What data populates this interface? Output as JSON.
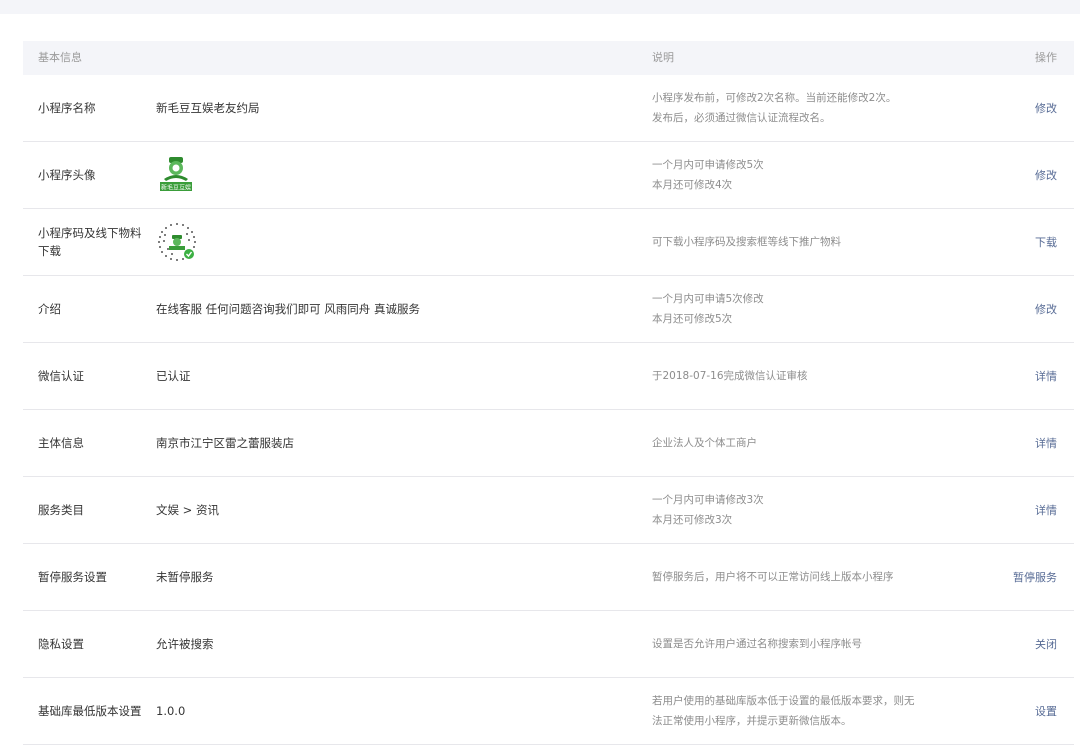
{
  "header": {
    "col_basic": "基本信息",
    "col_desc": "说明",
    "col_op": "操作"
  },
  "rows": [
    {
      "label": "小程序名称",
      "value": "新毛豆互娱老友约局",
      "desc1": "小程序发布前，可修改2次名称。当前还能修改2次。",
      "desc2": "发布后，必须通过微信认证流程改名。",
      "op": "修改"
    },
    {
      "label": "小程序头像",
      "value": "",
      "desc1": "一个月内可申请修改5次",
      "desc2": "本月还可修改4次",
      "op": "修改"
    },
    {
      "label": "小程序码及线下物料下载",
      "value": "",
      "desc1": "可下载小程序码及搜索框等线下推广物料",
      "desc2": "",
      "op": "下载"
    },
    {
      "label": "介绍",
      "value": "在线客服 任何问题咨询我们即可 风雨同舟 真诚服务",
      "desc1": "一个月内可申请5次修改",
      "desc2": "本月还可修改5次",
      "op": "修改"
    },
    {
      "label": "微信认证",
      "value": "已认证",
      "desc1": "于2018-07-16完成微信认证审核",
      "desc2": "",
      "op": "详情"
    },
    {
      "label": "主体信息",
      "value": "南京市江宁区雷之蕾服装店",
      "desc1": "企业法人及个体工商户",
      "desc2": "",
      "op": "详情"
    },
    {
      "label": "服务类目",
      "value": "文娱 > 资讯",
      "desc1": "一个月内可申请修改3次",
      "desc2": "本月还可修改3次",
      "op": "详情"
    },
    {
      "label": "暂停服务设置",
      "value": "未暂停服务",
      "desc1": "暂停服务后，用户将不可以正常访问线上版本小程序",
      "desc2": "",
      "op": "暂停服务"
    },
    {
      "label": "隐私设置",
      "value": "允许被搜索",
      "desc1": "设置是否允许用户通过名称搜索到小程序帐号",
      "desc2": "",
      "op": "关闭"
    },
    {
      "label": "基础库最低版本设置",
      "value": "1.0.0",
      "desc1": "若用户使用的基础库版本低于设置的最低版本要求，则无",
      "desc2": "法正常使用小程序，并提示更新微信版本。",
      "op": "设置"
    }
  ],
  "avatar_logo_text": "新毛豆互娱",
  "colors": {
    "link": "#576b95",
    "header_bg": "#f4f5f9",
    "avatar_green": "#2e8b2e"
  }
}
